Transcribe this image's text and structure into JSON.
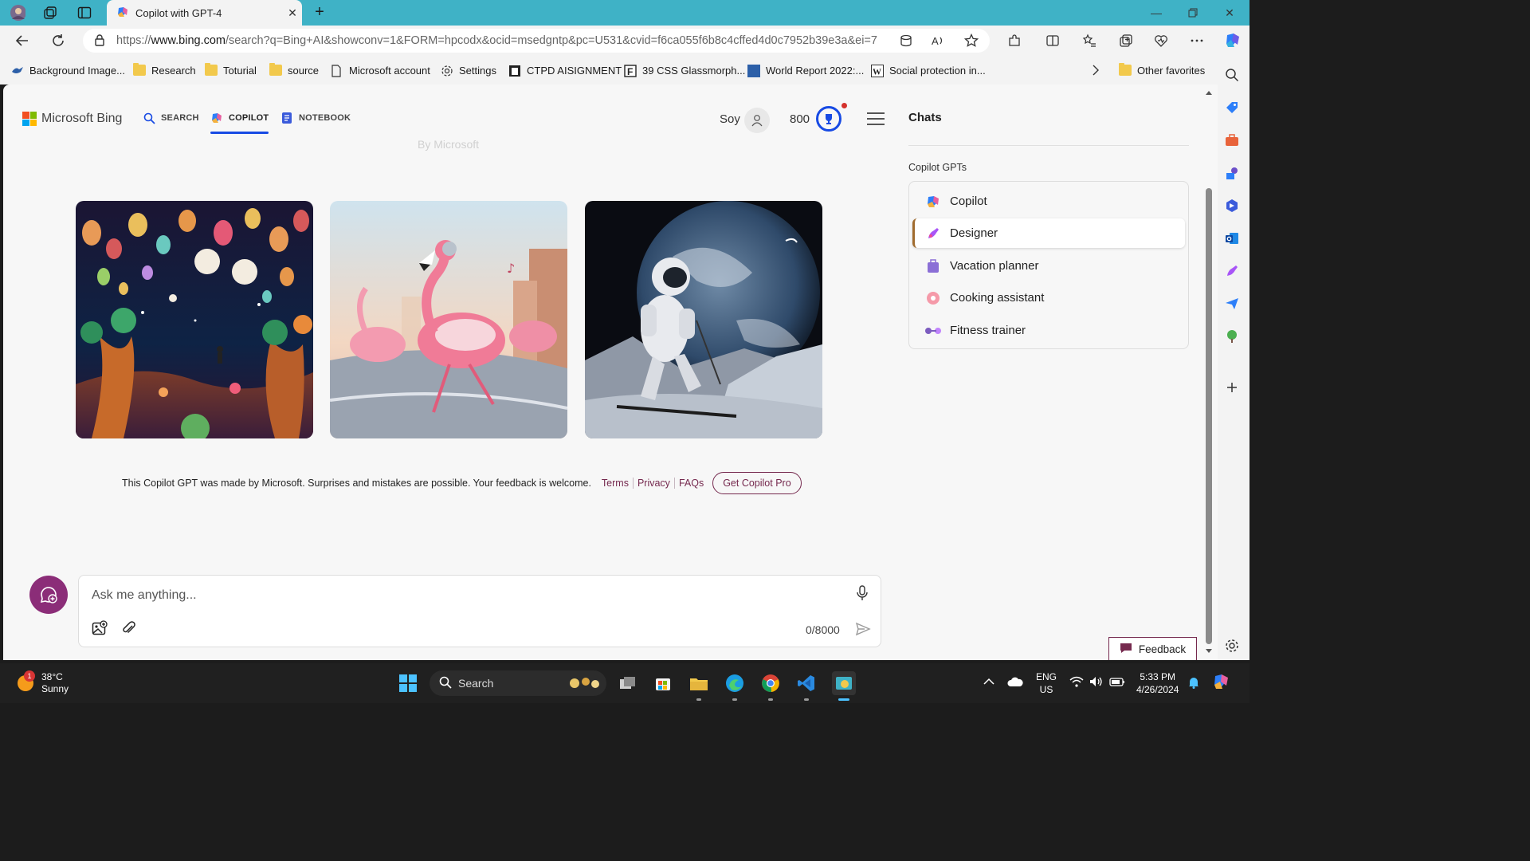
{
  "browser": {
    "tab_title": "Copilot with GPT-4",
    "url_prefix": "https://",
    "url_host": "www.bing.com",
    "url_path": "/search?q=Bing+AI&showconv=1&FORM=hpcodx&ocid=msedgntp&pc=U531&cvid=f6ca055f6b8c4cffed4d0c7952b39e3a&ei=7",
    "favorites": [
      "Background Image...",
      "Research",
      "Toturial",
      "source",
      "Microsoft account",
      "Settings",
      "CTPD AISIGNMENT",
      "39 CSS Glassmorph...",
      "World Report 2022:...",
      "Social protection in..."
    ],
    "other_favorites": "Other favorites"
  },
  "header": {
    "logo": "Microsoft Bing",
    "tabs": [
      "SEARCH",
      "COPILOT",
      "NOTEBOOK"
    ],
    "faded_text": "By Microsoft",
    "user_name": "Soy",
    "points": "800"
  },
  "sidebar": {
    "title": "Chats",
    "section_label": "Copilot GPTs",
    "items": [
      "Copilot",
      "Designer",
      "Vacation planner",
      "Cooking assistant",
      "Fitness trainer"
    ],
    "selected": "Designer"
  },
  "disclaimer": {
    "text": "This Copilot GPT was made by Microsoft. Surprises and mistakes are possible. Your feedback is welcome.",
    "links": [
      "Terms",
      "Privacy",
      "FAQs"
    ],
    "pro_button": "Get Copilot Pro"
  },
  "composer": {
    "placeholder": "Ask me anything...",
    "count": "0/8000"
  },
  "feedback": "Feedback",
  "taskbar": {
    "temperature": "38°C",
    "condition": "Sunny",
    "weather_badge": "1",
    "search": "Search",
    "lang1": "ENG",
    "lang2": "US",
    "time": "5:33 PM",
    "date": "4/26/2024"
  },
  "colors": {
    "accent": "#174ae4",
    "brand_plum": "#75294e",
    "titlebar": "#3fb2c6"
  }
}
